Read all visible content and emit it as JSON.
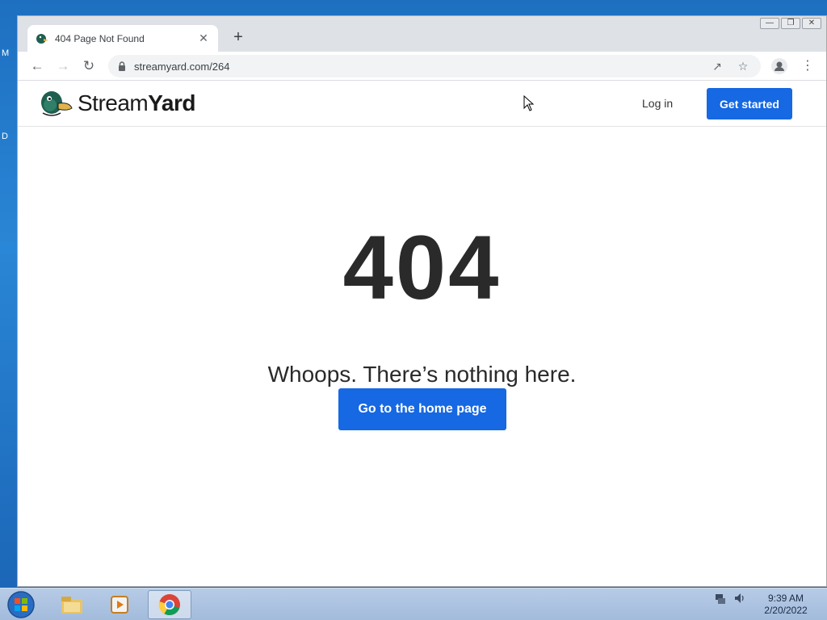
{
  "desktop": {
    "edge_letters": [
      "M",
      "D"
    ]
  },
  "browser": {
    "tab": {
      "title": "404 Page Not Found",
      "close_glyph": "✕"
    },
    "new_tab_glyph": "+",
    "window_controls": [
      "—",
      "❐",
      "✕"
    ],
    "address": {
      "url": "streamyard.com/264"
    }
  },
  "site": {
    "logo": {
      "word_light": "Stream",
      "word_bold": "Yard"
    },
    "nav": {
      "login": "Log in",
      "get_started": "Get started"
    },
    "error_code": "404",
    "message": "Whoops. There’s nothing here.",
    "home_button": "Go to the home page",
    "accent_color": "#1668e3"
  },
  "taskbar": {
    "clock": {
      "time": "9:39 AM",
      "date": "2/20/2022"
    }
  }
}
